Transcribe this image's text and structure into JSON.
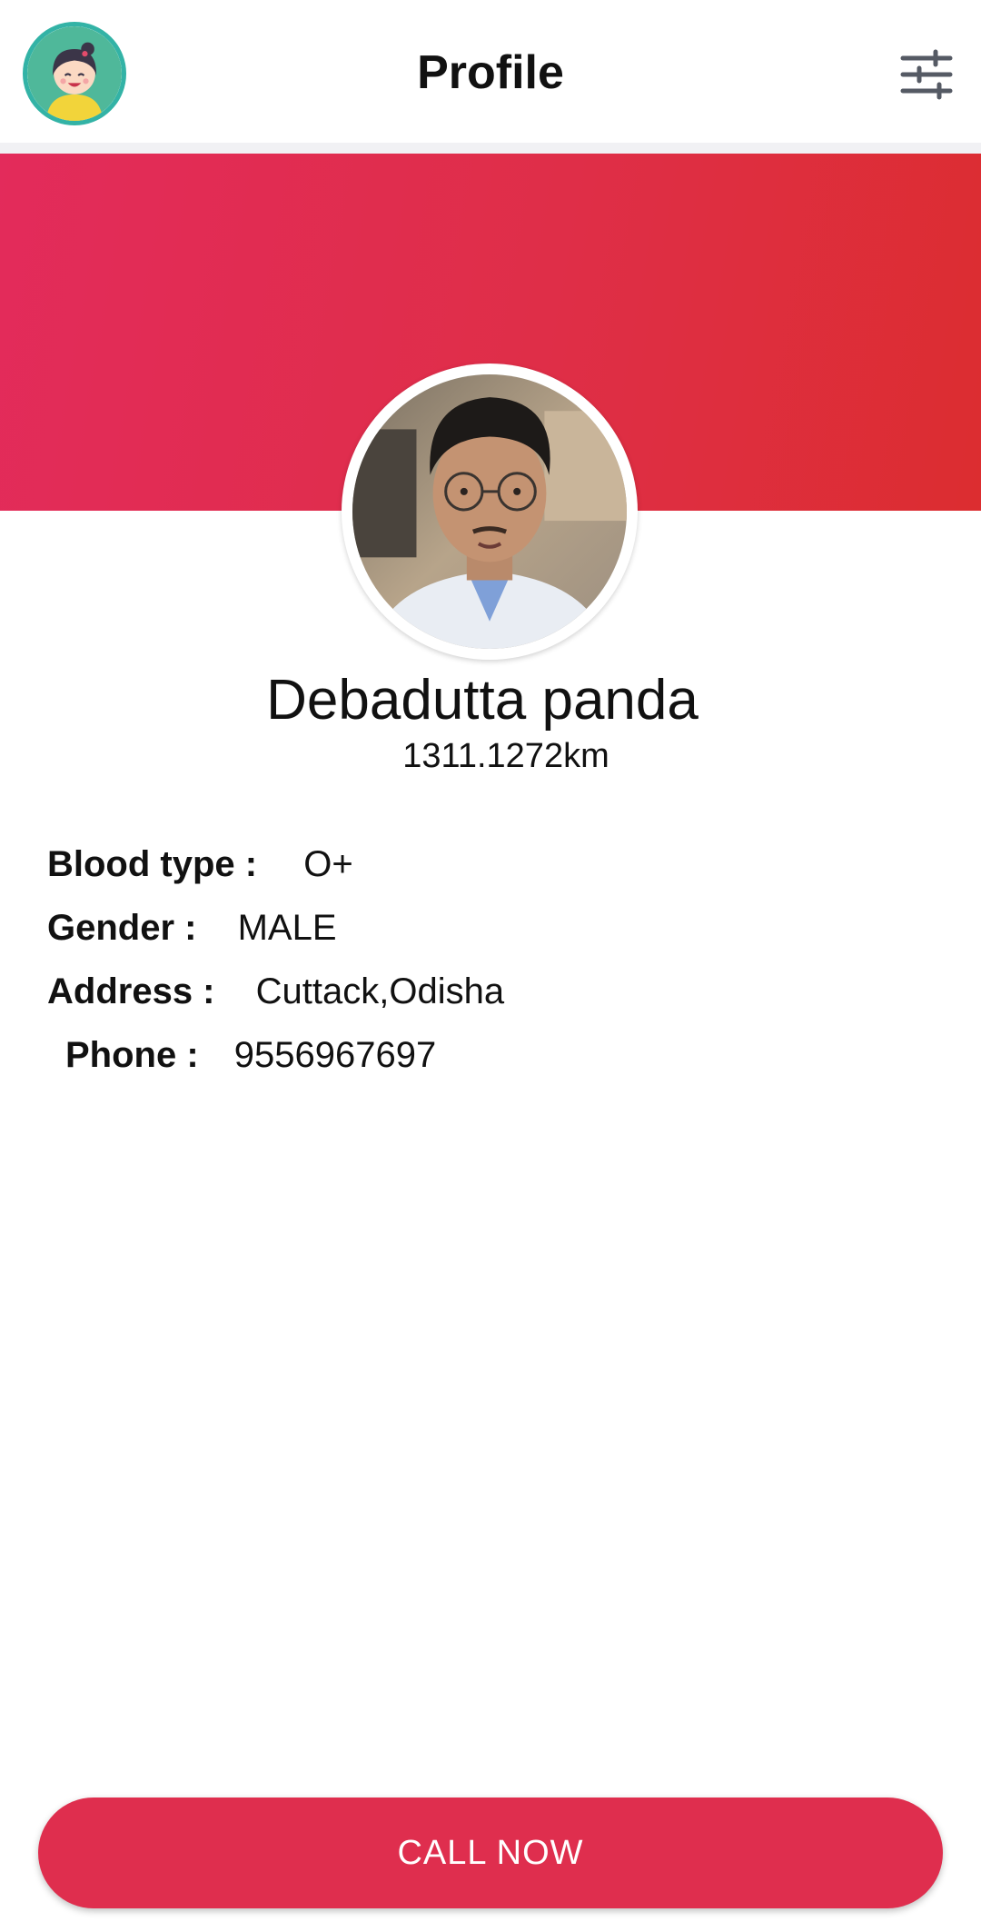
{
  "header": {
    "title": "Profile",
    "avatar_icon": "cartoon-girl-avatar-icon",
    "filter_icon": "sliders-icon"
  },
  "profile": {
    "name": "Debadutta panda",
    "distance": "1311.1272km"
  },
  "details": [
    {
      "label": "Blood type :",
      "value": "O+"
    },
    {
      "label": "Gender :",
      "value": "MALE"
    },
    {
      "label": "Address :",
      "value": "Cuttack,Odisha"
    },
    {
      "label": "Phone :",
      "value": "9556967697"
    }
  ],
  "actions": {
    "call_label": "CALL NOW"
  },
  "colors": {
    "banner_start": "#e32b5b",
    "banner_end": "#dc2d30",
    "accent": "#df2e4e",
    "avatar_ring": "#33b3a6"
  }
}
